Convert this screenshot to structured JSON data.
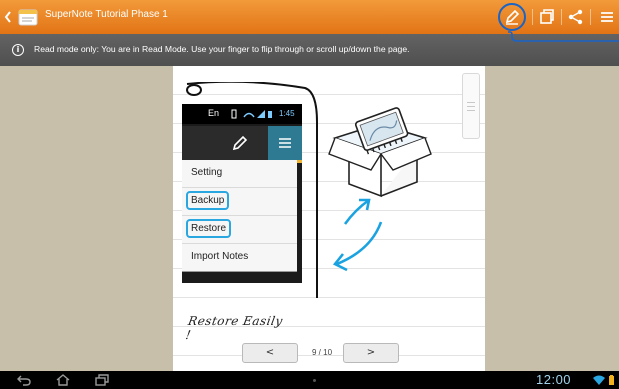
{
  "app": {
    "title": "SuperNote Tutorial Phase 1"
  },
  "info": {
    "message": "Read mode only: You are in Read Mode. Use your finger to flip through or scroll up/down the page."
  },
  "note": {
    "phone_language": "En",
    "phone_time": "1:45",
    "menu_items": [
      {
        "label": "Setting",
        "highlighted": false
      },
      {
        "label": "Backup",
        "highlighted": true
      },
      {
        "label": "Restore",
        "highlighted": true
      },
      {
        "label": "Import Notes",
        "highlighted": false
      }
    ],
    "handwriting": "Restore Easily !"
  },
  "pager": {
    "prev": "<",
    "next": ">",
    "current": "9",
    "separator": "/",
    "total": "10"
  },
  "system": {
    "clock": "12:00"
  },
  "colors": {
    "action_bar": "#e27415",
    "highlight": "#2aa7e1",
    "info_bar": "#565656"
  }
}
